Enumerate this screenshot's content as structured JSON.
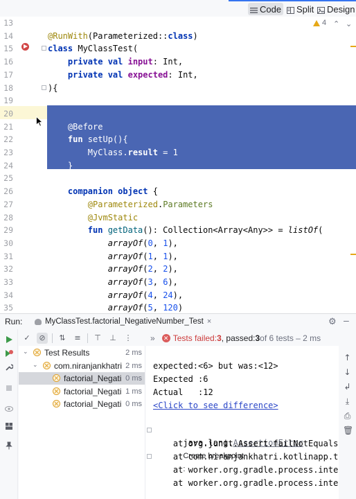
{
  "toolbar": {
    "views": [
      {
        "label": "Code",
        "icon": "code-view-icon",
        "active": true
      },
      {
        "label": "Split",
        "icon": "split-view-icon",
        "active": false
      },
      {
        "label": "Design",
        "icon": "design-view-icon",
        "active": false
      }
    ]
  },
  "editor": {
    "warning_count": "4",
    "lines": [
      {
        "n": "13",
        "tokens": []
      },
      {
        "n": "14",
        "tokens": [
          {
            "t": "@RunWith",
            "c": "ann"
          },
          {
            "t": "(Parameterized::",
            "c": ""
          },
          {
            "t": "class",
            "c": "kw"
          },
          {
            "t": ")",
            "c": ""
          }
        ]
      },
      {
        "n": "15",
        "tokens": [
          {
            "t": "class ",
            "c": "kw"
          },
          {
            "t": "MyClassTest(",
            "c": ""
          }
        ]
      },
      {
        "n": "16",
        "tokens": [
          {
            "t": "    private val ",
            "c": "kw"
          },
          {
            "t": "input",
            "c": "prop"
          },
          {
            "t": ": Int,",
            "c": ""
          }
        ]
      },
      {
        "n": "17",
        "tokens": [
          {
            "t": "    private val ",
            "c": "kw"
          },
          {
            "t": "expected",
            "c": "prop"
          },
          {
            "t": ": Int,",
            "c": ""
          }
        ]
      },
      {
        "n": "18",
        "tokens": [
          {
            "t": "){",
            "c": ""
          }
        ]
      },
      {
        "n": "19",
        "tokens": []
      },
      {
        "n": "20",
        "tokens": [],
        "sel": true
      },
      {
        "n": "21",
        "tokens": [
          {
            "t": "    @Before",
            "c": "ann"
          }
        ],
        "sel": true
      },
      {
        "n": "22",
        "tokens": [
          {
            "t": "    fun ",
            "c": "kw"
          },
          {
            "t": "setUp",
            "c": "fn"
          },
          {
            "t": "(){",
            "c": ""
          }
        ],
        "sel": true
      },
      {
        "n": "23",
        "tokens": [
          {
            "t": "        MyClass.",
            "c": ""
          },
          {
            "t": "result",
            "c": "prop"
          },
          {
            "t": " = ",
            "c": ""
          },
          {
            "t": "1",
            "c": "num"
          }
        ],
        "sel": true
      },
      {
        "n": "24",
        "tokens": [
          {
            "t": "    }",
            "c": ""
          }
        ],
        "sel": true
      },
      {
        "n": "25",
        "tokens": []
      },
      {
        "n": "26",
        "tokens": [
          {
            "t": "    companion object ",
            "c": "kw"
          },
          {
            "t": "{",
            "c": ""
          }
        ]
      },
      {
        "n": "27",
        "tokens": [
          {
            "t": "        @Parameterized",
            "c": "ann"
          },
          {
            "t": ".",
            "c": ""
          },
          {
            "t": "Parameters",
            "c": "pkg"
          }
        ]
      },
      {
        "n": "28",
        "tokens": [
          {
            "t": "        @JvmStatic",
            "c": "ann"
          }
        ]
      },
      {
        "n": "29",
        "tokens": [
          {
            "t": "        fun ",
            "c": "kw"
          },
          {
            "t": "getData",
            "c": "fn"
          },
          {
            "t": "(): Collection<Array<Any>> = ",
            "c": ""
          },
          {
            "t": "listOf",
            "c": "it"
          },
          {
            "t": "(",
            "c": ""
          }
        ]
      },
      {
        "n": "30",
        "tokens": [
          {
            "t": "            ",
            "c": ""
          },
          {
            "t": "arrayOf",
            "c": "it"
          },
          {
            "t": "(",
            "c": ""
          },
          {
            "t": "0",
            "c": "num"
          },
          {
            "t": ", ",
            "c": ""
          },
          {
            "t": "1",
            "c": "num"
          },
          {
            "t": "),",
            "c": ""
          }
        ]
      },
      {
        "n": "31",
        "tokens": [
          {
            "t": "            ",
            "c": ""
          },
          {
            "t": "arrayOf",
            "c": "it"
          },
          {
            "t": "(",
            "c": ""
          },
          {
            "t": "1",
            "c": "num"
          },
          {
            "t": ", ",
            "c": ""
          },
          {
            "t": "1",
            "c": "num"
          },
          {
            "t": "),",
            "c": ""
          }
        ]
      },
      {
        "n": "32",
        "tokens": [
          {
            "t": "            ",
            "c": ""
          },
          {
            "t": "arrayOf",
            "c": "it"
          },
          {
            "t": "(",
            "c": ""
          },
          {
            "t": "2",
            "c": "num"
          },
          {
            "t": ", ",
            "c": ""
          },
          {
            "t": "2",
            "c": "num"
          },
          {
            "t": "),",
            "c": ""
          }
        ]
      },
      {
        "n": "33",
        "tokens": [
          {
            "t": "            ",
            "c": ""
          },
          {
            "t": "arrayOf",
            "c": "it"
          },
          {
            "t": "(",
            "c": ""
          },
          {
            "t": "3",
            "c": "num"
          },
          {
            "t": ", ",
            "c": ""
          },
          {
            "t": "6",
            "c": "num"
          },
          {
            "t": "),",
            "c": ""
          }
        ]
      },
      {
        "n": "34",
        "tokens": [
          {
            "t": "            ",
            "c": ""
          },
          {
            "t": "arrayOf",
            "c": "it"
          },
          {
            "t": "(",
            "c": ""
          },
          {
            "t": "4",
            "c": "num"
          },
          {
            "t": ", ",
            "c": ""
          },
          {
            "t": "24",
            "c": "num"
          },
          {
            "t": "),",
            "c": ""
          }
        ]
      },
      {
        "n": "35",
        "tokens": [
          {
            "t": "            ",
            "c": ""
          },
          {
            "t": "arrayOf",
            "c": "it"
          },
          {
            "t": "(",
            "c": ""
          },
          {
            "t": "5",
            "c": "num"
          },
          {
            "t": ", ",
            "c": ""
          },
          {
            "t": "120",
            "c": "num"
          },
          {
            "t": ")",
            "c": ""
          }
        ]
      }
    ]
  },
  "run": {
    "label": "Run:",
    "tab_title": "MyClassTest.factorial_NegativeNumber_Test",
    "status": {
      "prefix": "Tests failed: ",
      "failed": "3",
      "mid": ", passed: ",
      "passed": "3",
      "suffix": " of 6 tests – 2 ms"
    },
    "tree": [
      {
        "name": "Test Results",
        "time": "2 ms",
        "level": 0,
        "arrow": "⌄",
        "selected": false
      },
      {
        "name": "com.niranjankhatri.",
        "time": "2 ms",
        "level": 1,
        "arrow": "⌄",
        "selected": false
      },
      {
        "name": "factorial_Negati",
        "time": "0 ms",
        "level": 2,
        "arrow": "",
        "selected": true
      },
      {
        "name": "factorial_Negati",
        "time": "1 ms",
        "level": 2,
        "arrow": "",
        "selected": false
      },
      {
        "name": "factorial_Negati",
        "time": "0 ms",
        "level": 2,
        "arrow": "",
        "selected": false
      }
    ],
    "output": {
      "expected_line": "expected:<6> but was:<12>",
      "expected_val": "Expected :6",
      "actual_val": "Actual   :12",
      "diff_link": "<Click to see difference>",
      "exception_prefix": "java.lang.",
      "exception_name": "AssertionError",
      "breakpoint": "Create breakpoint",
      "breakpoint_colon": ":",
      "stack": [
        {
          "text": "    at org.junit.Assert.failNotEquals(",
          "link": "Ass"
        },
        {
          "text": "    at com.niranjankhatri.kotlinapp.testi",
          "link": ""
        },
        {
          "text": "    at worker.org.gradle.process.interna",
          "link": ""
        },
        {
          "text": "    at worker.org.gradle.process.interna",
          "link": ""
        }
      ]
    }
  },
  "colors": {
    "selection": "#4a66b3",
    "accent": "#3574f0",
    "fail": "#db5c5c",
    "warning": "#e6a817"
  }
}
